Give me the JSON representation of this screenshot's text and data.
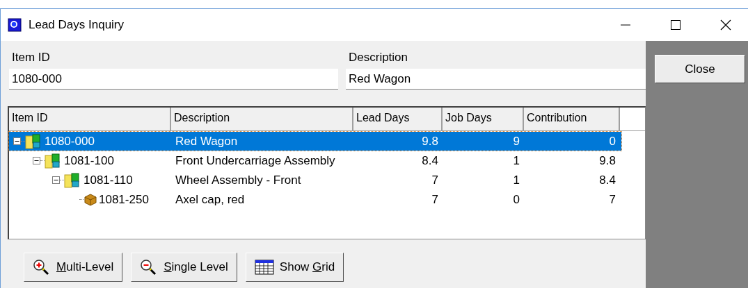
{
  "window": {
    "title": "Lead Days Inquiry"
  },
  "header_fields": [
    {
      "label": "Item ID",
      "value": "1080-000"
    },
    {
      "label": "Description",
      "value": "Red Wagon"
    }
  ],
  "side_buttons": [
    "Close"
  ],
  "grid": {
    "columns": [
      "Item ID",
      "Description",
      "Lead Days",
      "Job Days",
      "Contribution"
    ],
    "rows": [
      {
        "kind": "assembly",
        "item_id": "1080-000",
        "description": "Red Wagon",
        "lead_days": "9.8",
        "job_days": "9",
        "contribution": "0",
        "selected": true,
        "expanded": true,
        "children": [
          {
            "kind": "assembly",
            "item_id": "1081-100",
            "description": "Front Undercarriage Assembly",
            "lead_days": "8.4",
            "job_days": "1",
            "contribution": "9.8",
            "selected": false,
            "expanded": true,
            "children": [
              {
                "kind": "assembly",
                "item_id": "1081-110",
                "description": "Wheel Assembly - Front",
                "lead_days": "7",
                "job_days": "1",
                "contribution": "8.4",
                "selected": false,
                "expanded": true,
                "children": [
                  {
                    "kind": "part",
                    "item_id": "1081-250",
                    "description": "Axel cap, red",
                    "lead_days": "7",
                    "job_days": "0",
                    "contribution": "7",
                    "selected": false
                  }
                ]
              }
            ]
          }
        ]
      }
    ]
  },
  "buttons": [
    {
      "kind": "zoom-in",
      "label": {
        "key": "M",
        "after": "ulti-Level"
      }
    },
    {
      "kind": "zoom-out",
      "label": {
        "key": "S",
        "after": "ingle Level"
      }
    },
    {
      "kind": "grid",
      "label": {
        "before": "Show ",
        "key": "G",
        "after": "rid"
      }
    }
  ]
}
